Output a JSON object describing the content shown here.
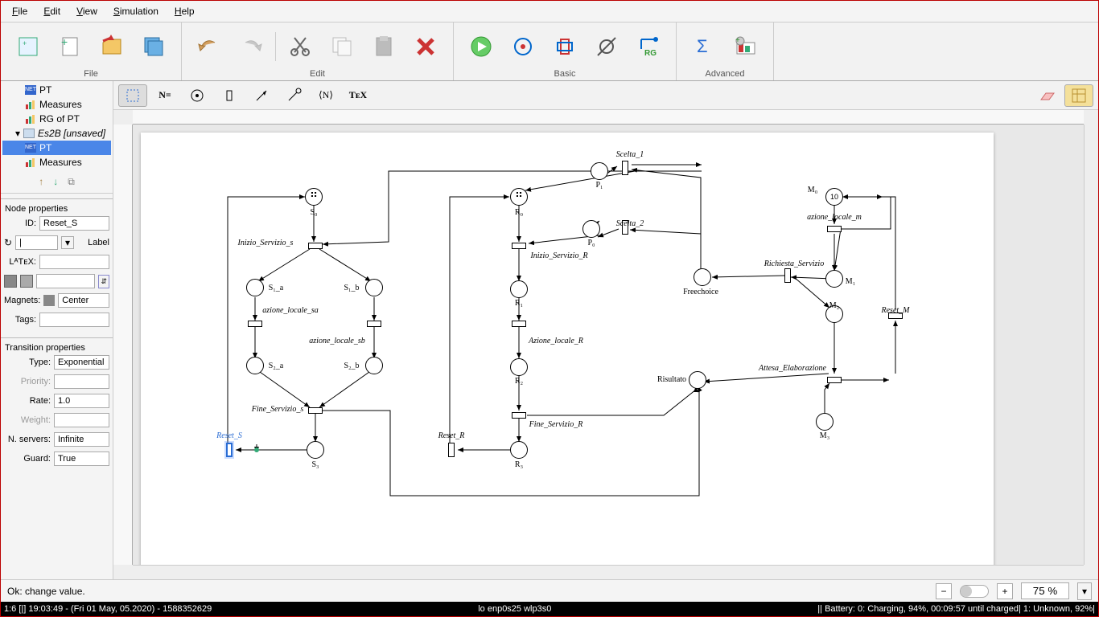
{
  "menu": {
    "file": "File",
    "edit": "Edit",
    "view": "View",
    "simulation": "Simulation",
    "help": "Help"
  },
  "toolgroups": {
    "file": "File",
    "edit": "Edit",
    "basic": "Basic",
    "advanced": "Advanced"
  },
  "tree": {
    "pt": "PT",
    "measures": "Measures",
    "rg": "RG of PT",
    "es2b": "Es2B [unsaved]",
    "es2b_pt": "PT",
    "es2b_meas": "Measures"
  },
  "props": {
    "node_section": "Node properties",
    "id_label": "ID:",
    "id_value": "Reset_S",
    "label_label": "Label",
    "rot_value": "|",
    "latex_label": "LᴬTᴇX:",
    "magnets_label": "Magnets:",
    "magnets_value": "Center",
    "tags_label": "Tags:",
    "trans_section": "Transition properties",
    "type_label": "Type:",
    "type_value": "Exponential",
    "priority_label": "Priority:",
    "rate_label": "Rate:",
    "rate_value": "1.0",
    "weight_label": "Weight:",
    "nservers_label": "N. servers:",
    "nservers_value": "Infinite",
    "guard_label": "Guard:",
    "guard_value": "True"
  },
  "toolstrip": {
    "neq": "N=",
    "angleN": "⟨N⟩",
    "tex": "TᴇX"
  },
  "status": {
    "msg": "Ok: change value.",
    "zoom": "75 %"
  },
  "sysbar": {
    "left": "1:6 [|]    19:03:49 - (Fri 01 May, 05.2020) - 1588352629",
    "mid": "lo enp0s25 wlp3s0",
    "right": "||  Battery: 0: Charging, 94%, 00:09:57 until charged| 1: Unknown, 92%|"
  },
  "net": {
    "places": {
      "S0": "S₀",
      "S1a": "S₁_a",
      "S1b": "S₁_b",
      "S2a": "S₂_a",
      "S2b": "S₂_b",
      "S3": "S₃",
      "R0": "R₀",
      "R1": "R₁",
      "R2": "R₂",
      "R3": "R₃",
      "P0": "P₀",
      "P1": "P₁",
      "M0": "M₀",
      "M1": "M₁",
      "M2": "M₂",
      "M3": "M₃",
      "Freechoice": "Freechoice",
      "Risultato": "Risultato",
      "tokcount": "10"
    },
    "transitions": {
      "Inizio_Servizio_s": "Inizio_Servizio_s",
      "azione_locale_sa": "azione_locale_sa",
      "azione_locale_sb": "azione_locale_sb",
      "Fine_Servizio_s": "Fine_Servizio_s",
      "Reset_S": "Reset_S",
      "Inizio_Servizio_R": "Inizio_Servizio_R",
      "Azione_locale_R": "Azione_locale_R",
      "Fine_Servizio_R": "Fine_Servizio_R",
      "Reset_R": "Reset_R",
      "Scelta_1": "Scelta_1",
      "Scelta_2": "Scelta_2",
      "azione_locale_m": "azione_locale_m",
      "Richiesta_Servizio": "Richiesta_Servizio",
      "Attesa_Elaborazione": "Attesa_Elaborazione",
      "Reset_M": "Reset_M"
    }
  }
}
